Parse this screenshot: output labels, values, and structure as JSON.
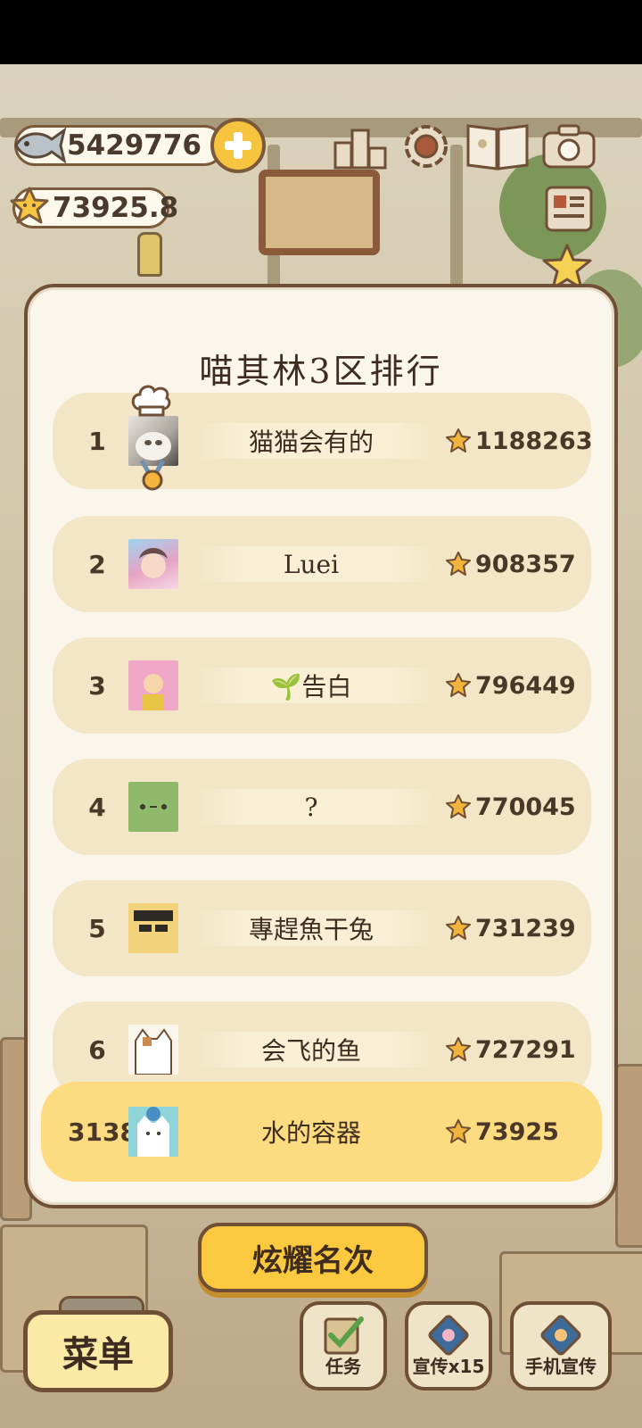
{
  "hud": {
    "fish_coins": "5429776",
    "star_rating": "73925.8"
  },
  "ranking": {
    "title": "喵其林3区排行",
    "rows": [
      {
        "rank": "1",
        "name": "猫猫会有的",
        "score": "1188263"
      },
      {
        "rank": "2",
        "name": "Luei",
        "score": "908357"
      },
      {
        "rank": "3",
        "name": "🌱告白",
        "score": "796449"
      },
      {
        "rank": "4",
        "name": "?",
        "score": "770045"
      },
      {
        "rank": "5",
        "name": "專趕魚干兔",
        "score": "731239"
      },
      {
        "rank": "6",
        "name": "会飞的鱼",
        "score": "727291"
      }
    ],
    "self": {
      "rank": "3138",
      "name": "水的容器",
      "score": "73925"
    }
  },
  "buttons": {
    "show_rank": "炫耀名次",
    "menu": "菜单",
    "tasks": "任务",
    "promote": "宣传x15",
    "phone_promote": "手机宣传"
  },
  "colors": {
    "panel_bg": "#fbf6ec",
    "row_bg": "#f3e6c7",
    "self_row_bg": "#fddb80",
    "accent_yellow": "#fbc940",
    "border_brown": "#6f4f36"
  }
}
